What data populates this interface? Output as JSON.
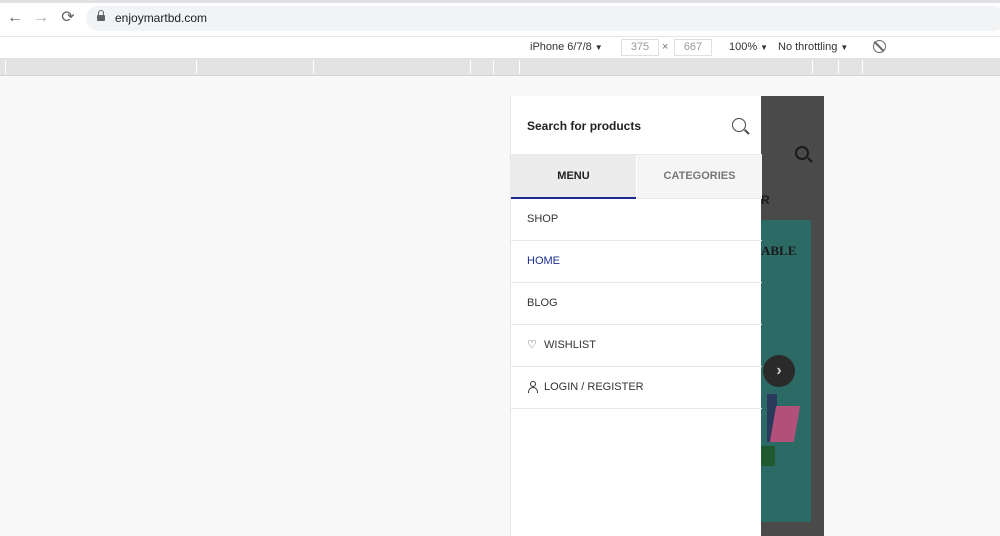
{
  "browser": {
    "url": "enjoymartbd.com",
    "nav": {
      "back": "←",
      "forward": "→",
      "reload": "⟳"
    }
  },
  "device_toolbar": {
    "device": "iPhone 6/7/8",
    "width": "375",
    "times": "×",
    "height": "667",
    "zoom": "100%",
    "throttling": "No throttling",
    "caret": "▼"
  },
  "page_background": {
    "partial_menu_text": "R",
    "partial_banner_text": "ABLE",
    "carousel_next": "›"
  },
  "side_menu": {
    "search_placeholder": "Search for products",
    "tabs": [
      {
        "label": "MENU",
        "active": true
      },
      {
        "label": "CATEGORIES",
        "active": false
      }
    ],
    "items": [
      {
        "label": "SHOP"
      },
      {
        "label": "HOME",
        "active": true
      },
      {
        "label": "BLOG"
      },
      {
        "label": "WISHLIST",
        "icon": "heart-icon"
      },
      {
        "label": "LOGIN / REGISTER",
        "icon": "user-icon"
      }
    ],
    "accent_color": "#1c2b8f"
  }
}
